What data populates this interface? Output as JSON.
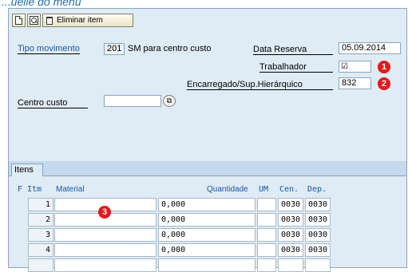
{
  "page_heading": "...uelle do menu",
  "toolbar": {
    "new_label": "",
    "search_label": "",
    "delete_label": "Eliminar item"
  },
  "header": {
    "movement_type_label": "Tipo movimento",
    "movement_type_code": "201",
    "movement_type_desc": "SM para centro custo",
    "reservation_date_label": "Data Reserva",
    "reservation_date_value": "05.09.2014",
    "worker_label": "Trabalhador",
    "worker_checked": true,
    "supervisor_label": "Encarregado/Sup.Hierárquico",
    "supervisor_value": "832",
    "cost_center_label": "Centro custo",
    "cost_center_value": ""
  },
  "annotations": [
    "1",
    "2",
    "3"
  ],
  "items_section": {
    "tab_label": "Itens",
    "columns": [
      "F",
      "Itm",
      "Material",
      "Quantidade",
      "UM",
      "Cen.",
      "Dep."
    ],
    "rows": [
      {
        "itm": "1",
        "material": "",
        "quantidade": "0,000",
        "um": "",
        "cen": "0030",
        "dep": "0030"
      },
      {
        "itm": "2",
        "material": "",
        "quantidade": "0,000",
        "um": "",
        "cen": "0030",
        "dep": "0030"
      },
      {
        "itm": "3",
        "material": "",
        "quantidade": "0,000",
        "um": "",
        "cen": "0030",
        "dep": "0030"
      },
      {
        "itm": "4",
        "material": "",
        "quantidade": "0,000",
        "um": "",
        "cen": "0030",
        "dep": "0030"
      }
    ]
  },
  "colors": {
    "screen_bg": "#dfebf5",
    "label_blue": "#1a56a8",
    "badge_red": "#e8161b"
  }
}
